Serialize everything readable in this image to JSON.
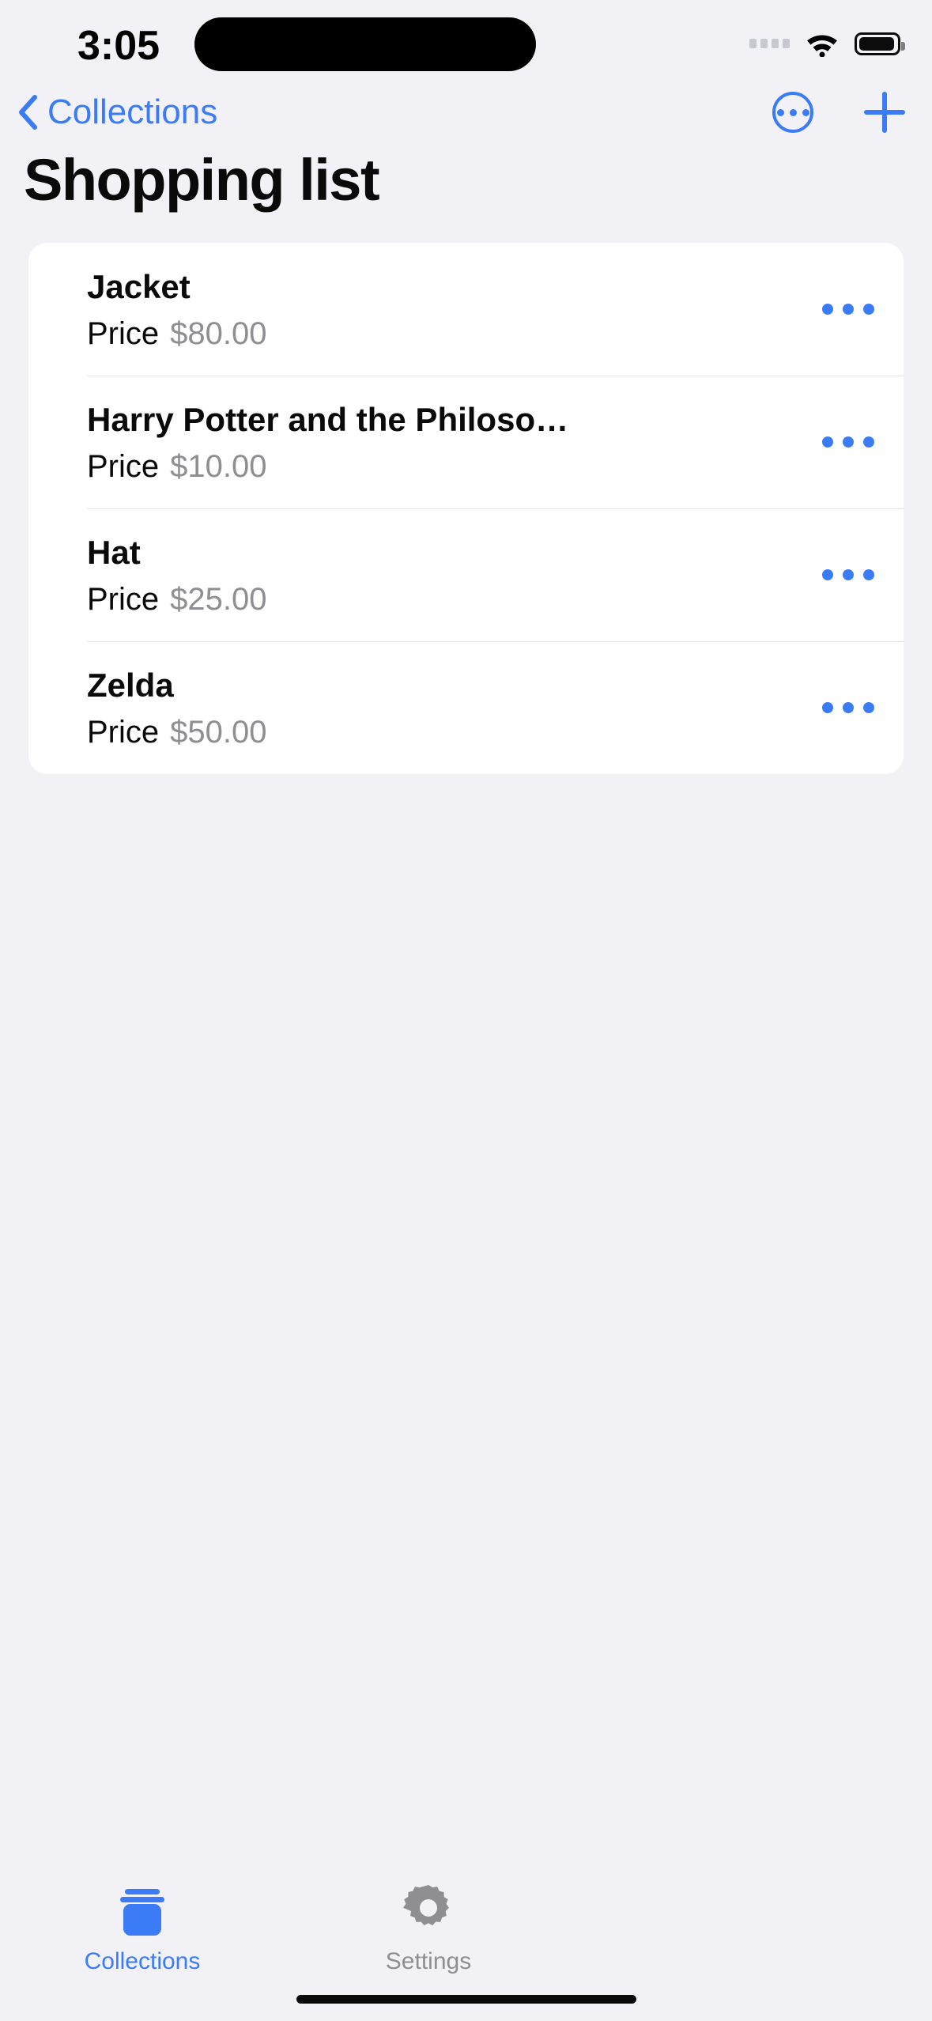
{
  "status_bar": {
    "time": "3:05",
    "signal_icon": "cellular-dots-icon",
    "wifi_icon": "wifi-icon",
    "battery_icon": "battery-full-icon"
  },
  "nav_bar": {
    "back_label": "Collections",
    "back_icon": "chevron-left-icon",
    "more_icon": "circle-ellipsis-icon",
    "add_icon": "plus-icon"
  },
  "page_title": "Shopping list",
  "list": {
    "price_label": "Price",
    "row_menu_icon": "ellipsis-icon",
    "items": [
      {
        "name": "Jacket",
        "price_label": "Price",
        "price": "$80.00"
      },
      {
        "name": "Harry Potter and the Philosop...",
        "price_label": "Price",
        "price": "$10.00"
      },
      {
        "name": "Hat",
        "price_label": "Price",
        "price": "$25.00"
      },
      {
        "name": "Zelda",
        "price_label": "Price",
        "price": "$50.00"
      }
    ]
  },
  "tab_bar": {
    "tabs": [
      {
        "label": "Collections",
        "icon": "square-stack-icon",
        "selected": true
      },
      {
        "label": "Settings",
        "icon": "gear-icon",
        "selected": false
      }
    ]
  },
  "colors": {
    "accent": "#3b7cf6",
    "background": "#f1f1f6",
    "card": "#ffffff",
    "secondary_text": "#8e8e93",
    "primary_text": "#0a0a0a",
    "separator": "#e2e2e6"
  }
}
